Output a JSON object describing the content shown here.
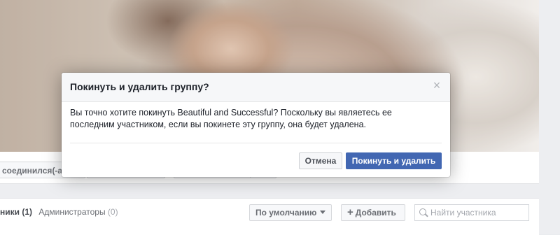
{
  "background": {
    "joined_button": "соединился(-ась)",
    "members_tab": {
      "label": "ники",
      "count": "(1)",
      "admins_label": "Администраторы",
      "admins_count": "(0)"
    },
    "sort_button": "По умолчанию",
    "add_button": "Добавить",
    "search": {
      "placeholder": "Найти участника"
    }
  },
  "dialog": {
    "title": "Покинуть и удалить группу?",
    "close_glyph": "×",
    "message": "Вы точно хотите покинуть Beautiful and Successful? Поскольку вы являетесь ее последним участником, если вы покинете эту группу, она будет удалена.",
    "cancel_label": "Отмена",
    "confirm_label": "Покинуть и удалить"
  },
  "colors": {
    "primary": "#4267b2",
    "page_bg": "#e9ebee"
  }
}
